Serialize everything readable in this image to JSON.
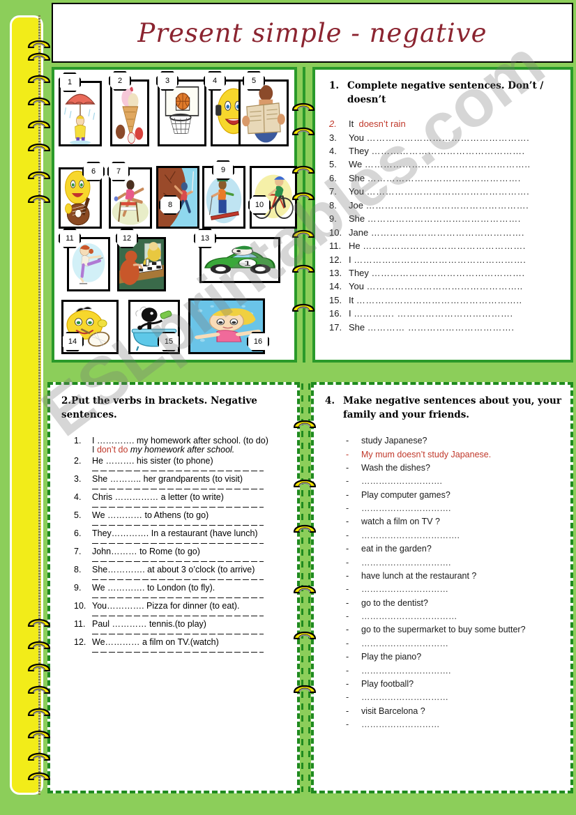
{
  "page": {
    "title": "Present simple - negative",
    "watermark": "ESLprintables.com",
    "colors": {
      "page_green": "#8cce5a",
      "panel_border_green": "#2a9a2a",
      "dashed_border_green": "#1f8a1f",
      "binder_yellow": "#f2ec19",
      "title_red": "#8b2430",
      "answer_red": "#c0392b"
    }
  },
  "pictures": {
    "numbers": [
      "1",
      "2",
      "3",
      "4",
      "5",
      "6",
      "7",
      "8",
      "9",
      "10",
      "11",
      "12",
      "13",
      "14",
      "15",
      "16"
    ],
    "icons": [
      "girl-with-umbrella-in-rain-icon",
      "ice-cream-cone-icon",
      "basketball-hoop-icon",
      "smiley-on-phone-icon",
      "person-reading-newspaper-icon",
      "smiley-playing-guitar-icon",
      "hurdle-runner-icon",
      "rock-climber-icon",
      "skier-icon",
      "cyclist-icon",
      "ice-skater-icon",
      "people-playing-chess-icon",
      "green-racing-car-icon",
      "smiley-playing-tennis-icon",
      "person-in-bathtub-icon",
      "girl-swimming-icon"
    ]
  },
  "exercise1": {
    "number": "1.",
    "heading_line1": "Complete   negative   sentences.   Don’t   /",
    "heading_line2": "doesn’t",
    "items": [
      {
        "n": "2.",
        "subject": "It",
        "answer": "doesn’t rain",
        "dots": "",
        "example": true
      },
      {
        "n": "3.",
        "subject": "You",
        "answer": "",
        "dots": "…………………………………………….",
        "example": false
      },
      {
        "n": "4.",
        "subject": "They",
        "answer": "",
        "dots": "………………………………………….",
        "example": false
      },
      {
        "n": "5.",
        "subject": "We",
        "answer": "",
        "dots": "……………………………………………..",
        "example": false
      },
      {
        "n": "6.",
        "subject": "She",
        "answer": "",
        "dots": "………………………………………….",
        "example": false
      },
      {
        "n": "7.",
        "subject": "You",
        "answer": "",
        "dots": "…………………………………………….",
        "example": false
      },
      {
        "n": "8.",
        "subject": "Joe",
        "answer": "",
        "dots": "…………………………………………….",
        "example": false
      },
      {
        "n": "9.",
        "subject": "She",
        "answer": "",
        "dots": "………………………………………….",
        "example": false
      },
      {
        "n": "10.",
        "subject": "Jane",
        "answer": "",
        "dots": "………………………………………….",
        "example": false
      },
      {
        "n": "11.",
        "subject": "He",
        "answer": "",
        "dots": "…………………………………………….",
        "example": false
      },
      {
        "n": "12.",
        "subject": "I",
        "answer": "",
        "dots": "……………………………………………….",
        "example": false
      },
      {
        "n": "13.",
        "subject": "They",
        "answer": "",
        "dots": "………………………………………….",
        "example": false
      },
      {
        "n": "14.",
        "subject": "You",
        "answer": "",
        "dots": "…………………………………………..",
        "example": false
      },
      {
        "n": "15.",
        "subject": "It",
        "answer": "",
        "dots": "……………………………………………..",
        "example": false
      },
      {
        "n": "16.",
        "subject": "I",
        "answer": "",
        "dots": "…………. ……………………………….",
        "example": false
      },
      {
        "n": "17.",
        "subject": "She",
        "answer": "",
        "dots": "………… …………………………….",
        "example": false
      }
    ]
  },
  "exercise2": {
    "number": "2.",
    "heading_line1": "Put     the     verbs     in     brackets.     Negative",
    "heading_line2": "sentences.",
    "items": [
      {
        "n": "1.",
        "text": "I …………. my homework after school. (to do)",
        "answer_red": "don’t do",
        "answer_prefix": "I ",
        "answer_italic": "my homework after school.",
        "rule": false
      },
      {
        "n": "2.",
        "text": "He ………. his sister (to phone)",
        "rule": true
      },
      {
        "n": "3.",
        "text": "She ……….. her grandparents (to visit)",
        "rule": true
      },
      {
        "n": "4.",
        "text": "Chris …………… a letter (to write)",
        "rule": true
      },
      {
        "n": "5.",
        "text": "We ………… to Athens (to go)",
        "rule": true
      },
      {
        "n": "6.",
        "text": "They…………. In a restaurant (have lunch)",
        "rule": true
      },
      {
        "n": "7.",
        "text": "John……… to Rome  (to go)",
        "rule": true
      },
      {
        "n": "8.",
        "text": "She………….  at about 3 o’clock (to arrive)",
        "rule": true
      },
      {
        "n": "9.",
        "text": "We …………. to London (to fly).",
        "rule": true
      },
      {
        "n": "10.",
        "text": "You…………. Pizza for dinner (to eat).",
        "rule": true
      },
      {
        "n": "11.",
        "text": "Paul ………… tennis.(to play)",
        "rule": true
      },
      {
        "n": "12.",
        "text": "We………… a film on TV.(watch)",
        "rule": true
      }
    ]
  },
  "exercise4": {
    "number": "4.",
    "heading_line1": "Make  negative  sentences  about  you,  your",
    "heading_line2": "family and your friends.",
    "items": [
      {
        "dash": "-",
        "text": " study Japanese?",
        "style": "normal"
      },
      {
        "dash": "-",
        "text": " My mum doesn’t study Japanese.",
        "style": "example"
      },
      {
        "dash": "-",
        "text": "Wash the dishes?",
        "style": "normal"
      },
      {
        "dash": "-",
        "text": "……………………….",
        "style": "dots"
      },
      {
        "dash": "-",
        "text": "Play computer games?",
        "style": "normal"
      },
      {
        "dash": "-",
        "text": "………………………….",
        "style": "dots"
      },
      {
        "dash": "-",
        "text": "watch a film on TV ?",
        "style": "normal"
      },
      {
        "dash": "-",
        "text": "…………………………….",
        "style": "dots"
      },
      {
        "dash": "-",
        "text": "eat in the garden?",
        "style": "normal"
      },
      {
        "dash": "-",
        "text": "………………………….",
        "style": "dots"
      },
      {
        "dash": "-",
        "text": " have lunch at the restaurant ?",
        "style": "normal"
      },
      {
        "dash": "-",
        "text": "…………………………",
        "style": "dots"
      },
      {
        "dash": "-",
        "text": " go to the dentist?",
        "style": "normal"
      },
      {
        "dash": "-",
        "text": "……………………………",
        "style": "dots"
      },
      {
        "dash": "-",
        "text": " go to the supermarket to buy some butter?",
        "style": "normal"
      },
      {
        "dash": "-",
        "text": "…………………………",
        "style": "dots"
      },
      {
        "dash": "-",
        "text": "Play the piano?",
        "style": "normal"
      },
      {
        "dash": "-",
        "text": "………………………….",
        "style": "dots"
      },
      {
        "dash": "-",
        "text": "Play football?",
        "style": "normal"
      },
      {
        "dash": "-",
        "text": "…………………………",
        "style": "dots"
      },
      {
        "dash": "-",
        "text": "visit Barcelona ?",
        "style": "normal"
      },
      {
        "dash": "-",
        "text": "………………………",
        "style": "dots"
      }
    ]
  }
}
